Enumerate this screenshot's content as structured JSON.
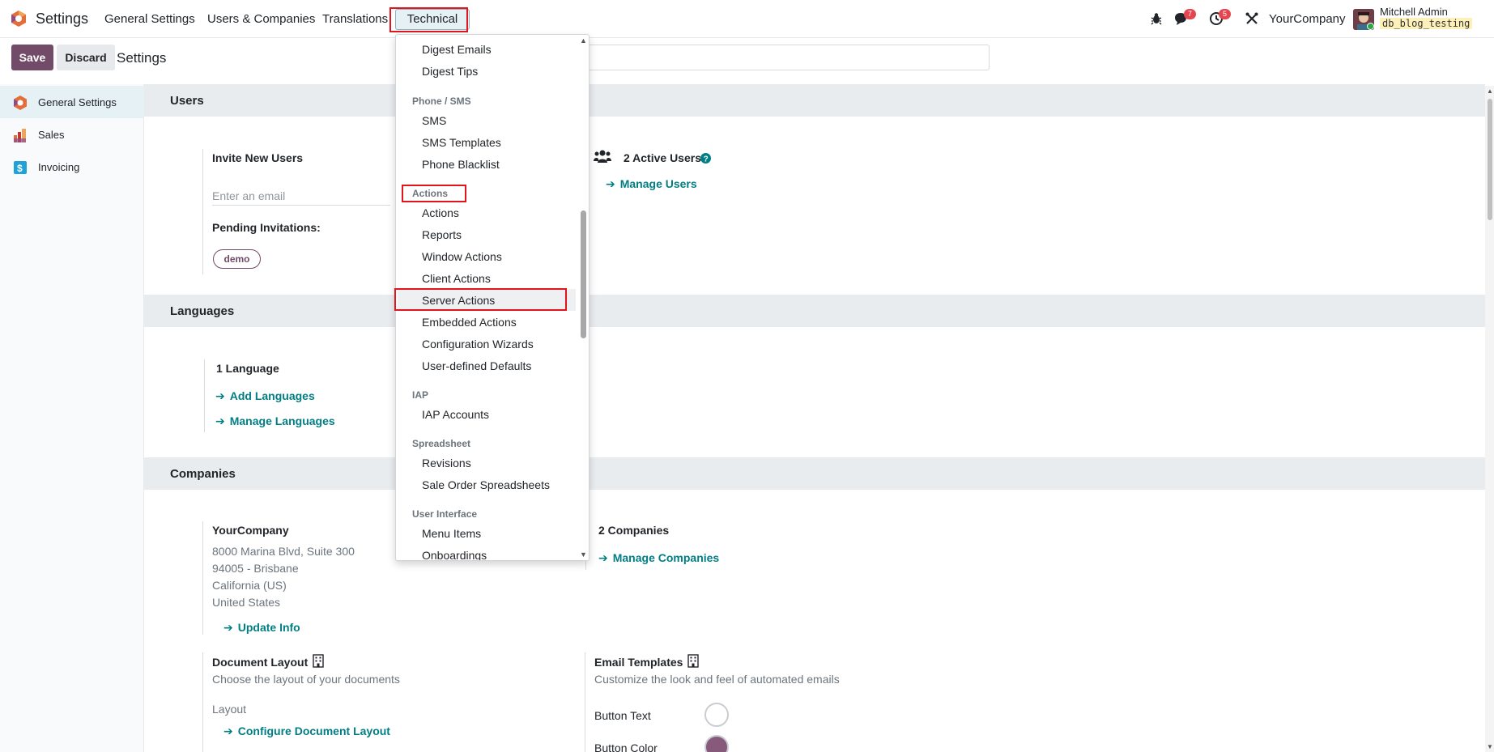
{
  "navbar": {
    "app_name": "Settings",
    "menus": [
      "General Settings",
      "Users & Companies",
      "Translations",
      "Technical"
    ],
    "messages_count": "7",
    "activities_count": "5",
    "company": "YourCompany",
    "user_name": "Mitchell Admin",
    "db_name": "db_blog_testing"
  },
  "control": {
    "save_label": "Save",
    "discard_label": "Discard",
    "title": "Settings"
  },
  "sidebar": {
    "items": [
      {
        "label": "General Settings",
        "icon": "settings-app-icon",
        "active": true
      },
      {
        "label": "Sales",
        "icon": "sales-app-icon"
      },
      {
        "label": "Invoicing",
        "icon": "invoicing-app-icon"
      }
    ]
  },
  "users_section": {
    "title": "Users",
    "invite_label": "Invite New Users",
    "email_placeholder": "Enter an email",
    "pending_label": "Pending Invitations:",
    "pending_tag": "demo",
    "active_users": "2 Active Users",
    "manage_users": "Manage Users"
  },
  "languages_section": {
    "title": "Languages",
    "count": "1 Language",
    "add_languages": "Add Languages",
    "manage_languages": "Manage Languages"
  },
  "companies_section": {
    "title": "Companies",
    "company_name": "YourCompany",
    "address_line1": "8000 Marina Blvd, Suite 300",
    "address_line2": "94005 - Brisbane",
    "address_line3": "California (US)",
    "address_line4": "United States",
    "update_info": "Update Info",
    "companies_count": "2 Companies",
    "manage_companies": "Manage Companies",
    "doc_layout_title": "Document Layout",
    "doc_layout_desc": "Choose the layout of your documents",
    "layout_label": "Layout",
    "configure_layout": "Configure Document Layout",
    "email_templates_title": "Email Templates",
    "email_templates_desc": "Customize the look and feel of automated emails",
    "button_text_label": "Button Text",
    "button_color_label": "Button Color",
    "button_text_color": "#ffffff",
    "button_color": "#875a7b"
  },
  "dropdown": {
    "items": {
      "digest_emails": "Digest Emails",
      "digest_tips": "Digest Tips",
      "phone_sms_header": "Phone / SMS",
      "sms": "SMS",
      "sms_templates": "SMS Templates",
      "phone_blacklist": "Phone Blacklist",
      "actions_header": "Actions",
      "actions": "Actions",
      "reports": "Reports",
      "window_actions": "Window Actions",
      "client_actions": "Client Actions",
      "server_actions": "Server Actions",
      "embedded_actions": "Embedded Actions",
      "configuration_wizards": "Configuration Wizards",
      "user_defined_defaults": "User-defined Defaults",
      "iap_header": "IAP",
      "iap_accounts": "IAP Accounts",
      "spreadsheet_header": "Spreadsheet",
      "revisions": "Revisions",
      "sale_order_spreadsheets": "Sale Order Spreadsheets",
      "user_interface_header": "User Interface",
      "menu_items": "Menu Items",
      "onboardings": "Onboardings"
    }
  },
  "colors": {
    "brand": "#714b67",
    "link": "#017e84",
    "highlight_box": "#e3141b"
  }
}
